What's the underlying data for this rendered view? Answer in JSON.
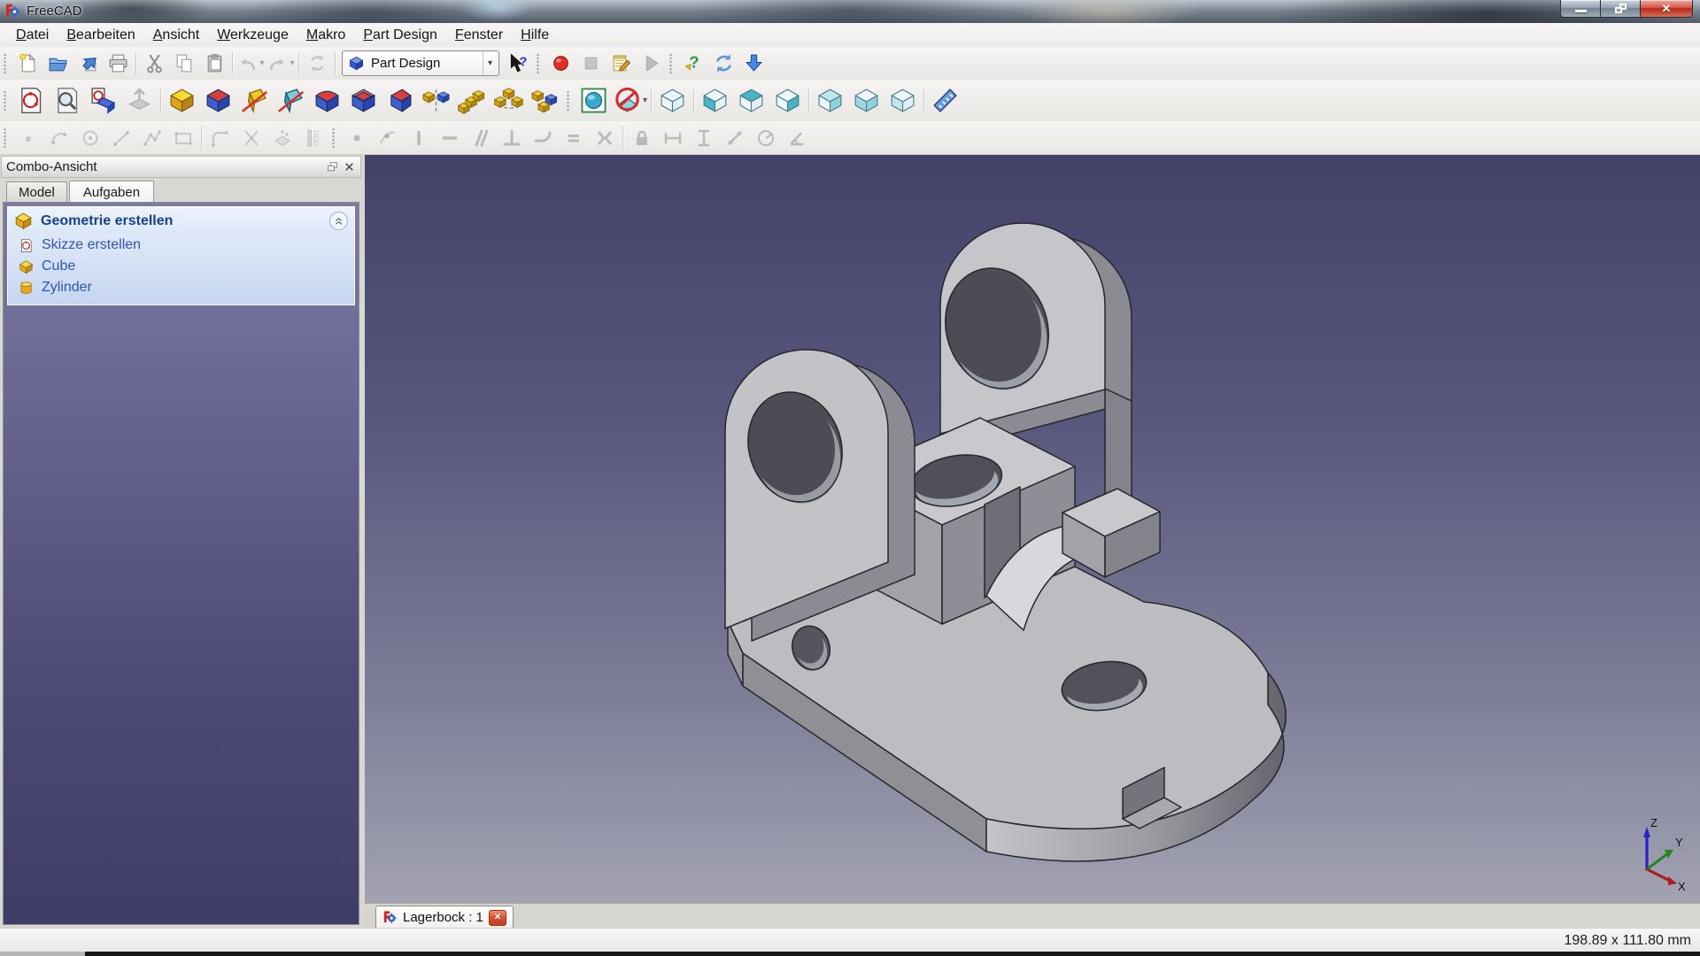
{
  "window": {
    "title": "FreeCAD",
    "controls": [
      {
        "name": "minimize-button"
      },
      {
        "name": "restore-button"
      },
      {
        "name": "close-button"
      }
    ]
  },
  "menubar": {
    "items": [
      "Datei",
      "Bearbeiten",
      "Ansicht",
      "Werkzeuge",
      "Makro",
      "Part Design",
      "Fenster",
      "Hilfe"
    ]
  },
  "workbench_selector": {
    "value": "Part Design"
  },
  "toolbars": {
    "file": [
      {
        "items": [
          {
            "name": "new-file"
          },
          {
            "name": "open"
          },
          {
            "name": "save"
          },
          {
            "name": "print"
          }
        ]
      },
      {
        "items": [
          {
            "name": "cut"
          },
          {
            "name": "copy"
          },
          {
            "name": "paste"
          }
        ]
      },
      {
        "items": [
          {
            "name": "undo",
            "caret": true,
            "disabled": true
          },
          {
            "name": "redo",
            "caret": true,
            "disabled": true
          }
        ]
      },
      {
        "items": [
          {
            "name": "refresh",
            "disabled": true
          }
        ]
      },
      {
        "items": [
          {
            "name": "workbench-selector",
            "type": "combo",
            "value": "Part Design"
          },
          {
            "name": "whats-this"
          }
        ]
      }
    ],
    "macro": [
      {
        "items": [
          {
            "name": "macro-record"
          },
          {
            "name": "macro-stop",
            "disabled": true
          },
          {
            "name": "macro-edit"
          },
          {
            "name": "macro-play",
            "disabled": true
          }
        ]
      }
    ],
    "web": [
      {
        "items": [
          {
            "name": "online-help"
          },
          {
            "name": "web-refresh"
          },
          {
            "name": "download"
          }
        ]
      }
    ],
    "partdesign": [
      {
        "items": [
          {
            "name": "sketch-new"
          },
          {
            "name": "sketch-view"
          },
          {
            "name": "sketch-map"
          },
          {
            "name": "sketch-reorient",
            "disabled": true
          }
        ]
      },
      {
        "items": [
          {
            "name": "pad"
          },
          {
            "name": "pocket"
          },
          {
            "name": "revolution"
          },
          {
            "name": "groove"
          },
          {
            "name": "fillet"
          },
          {
            "name": "chamfer"
          },
          {
            "name": "draft"
          },
          {
            "name": "mirrored"
          },
          {
            "name": "linear-pattern"
          },
          {
            "name": "polar-pattern"
          },
          {
            "name": "multi-transform"
          }
        ]
      }
    ],
    "view": [
      {
        "items": [
          {
            "name": "fit-all"
          },
          {
            "name": "draw-style",
            "caret": true
          }
        ]
      },
      {
        "items": [
          {
            "name": "view-axonometric"
          }
        ]
      },
      {
        "items": [
          {
            "name": "view-front"
          },
          {
            "name": "view-top"
          },
          {
            "name": "view-right"
          }
        ]
      },
      {
        "items": [
          {
            "name": "view-rear"
          },
          {
            "name": "view-bottom"
          },
          {
            "name": "view-left"
          }
        ]
      },
      {
        "items": [
          {
            "name": "measure-distance"
          }
        ]
      }
    ],
    "sketcher_geometry": [
      {
        "items": [
          {
            "name": "sk-point",
            "disabled": true
          },
          {
            "name": "sk-arc",
            "disabled": true
          },
          {
            "name": "sk-circle",
            "disabled": true
          },
          {
            "name": "sk-line",
            "disabled": true
          },
          {
            "name": "sk-polyline",
            "disabled": true
          },
          {
            "name": "sk-rectangle",
            "disabled": true
          }
        ]
      },
      {
        "items": [
          {
            "name": "sk-fillet",
            "disabled": true
          },
          {
            "name": "sk-trim",
            "disabled": true
          },
          {
            "name": "sk-external",
            "disabled": true
          },
          {
            "name": "sk-construction",
            "disabled": true
          }
        ]
      }
    ],
    "sketcher_constraints": [
      {
        "items": [
          {
            "name": "constraint-coincident",
            "disabled": true
          },
          {
            "name": "constraint-point-on-object",
            "disabled": true
          },
          {
            "name": "constraint-vertical",
            "disabled": true
          },
          {
            "name": "constraint-horizontal",
            "disabled": true
          },
          {
            "name": "constraint-parallel",
            "disabled": true
          },
          {
            "name": "constraint-perpendicular",
            "disabled": true
          },
          {
            "name": "constraint-tangent",
            "disabled": true
          },
          {
            "name": "constraint-equal",
            "disabled": true
          },
          {
            "name": "constraint-symmetric",
            "disabled": true
          }
        ]
      },
      {
        "items": [
          {
            "name": "constraint-lock",
            "disabled": true
          },
          {
            "name": "constraint-distance-x",
            "disabled": true
          },
          {
            "name": "constraint-distance-y",
            "disabled": true
          },
          {
            "name": "constraint-distance",
            "disabled": true
          },
          {
            "name": "constraint-radius",
            "disabled": true
          },
          {
            "name": "constraint-angle",
            "disabled": true
          }
        ]
      }
    ]
  },
  "combo_view": {
    "title": "Combo-Ansicht",
    "tabs": [
      {
        "label": "Model",
        "active": false
      },
      {
        "label": "Aufgaben",
        "active": true
      }
    ],
    "task_panel": {
      "header": "Geometrie erstellen",
      "items": [
        {
          "icon": "sketch",
          "label": "Skizze erstellen"
        },
        {
          "icon": "cube",
          "label": "Cube"
        },
        {
          "icon": "cylinder",
          "label": "Zylinder"
        }
      ]
    }
  },
  "viewport": {
    "axis_labels": {
      "x": "X",
      "y": "Y",
      "z": "Z"
    },
    "axis_colors": {
      "x": "#a81c1c",
      "y": "#1f8a1f",
      "z": "#2424c4"
    }
  },
  "document_tabs": [
    {
      "label": "Lagerbock : 1",
      "active": true
    }
  ],
  "status_bar": {
    "right_text": "198.89 x 111.80 mm"
  },
  "colors": {
    "task_header": "#16418e",
    "task_link": "#2a57b0",
    "viewport_top": "#434369",
    "viewport_bottom": "#a2a2b2",
    "part_light": "#c6c6ca",
    "part_mid": "#a8a8ac",
    "part_dark": "#8e8e96"
  }
}
